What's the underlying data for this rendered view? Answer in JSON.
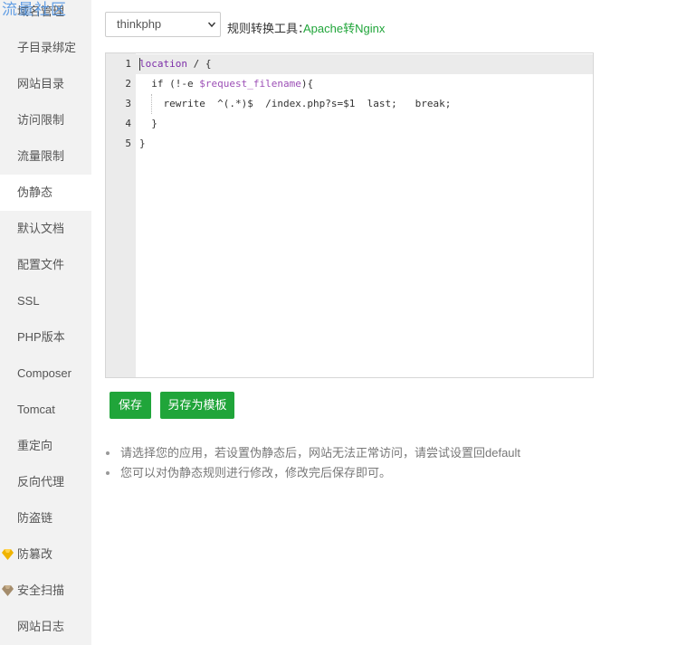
{
  "watermark": "流量社区",
  "sidebar": {
    "items": [
      {
        "label": "域名管理",
        "icon": ""
      },
      {
        "label": "子目录绑定",
        "icon": ""
      },
      {
        "label": "网站目录",
        "icon": ""
      },
      {
        "label": "访问限制",
        "icon": ""
      },
      {
        "label": "流量限制",
        "icon": ""
      },
      {
        "label": "伪静态",
        "icon": "",
        "active": true
      },
      {
        "label": "默认文档",
        "icon": ""
      },
      {
        "label": "配置文件",
        "icon": ""
      },
      {
        "label": "SSL",
        "icon": ""
      },
      {
        "label": "PHP版本",
        "icon": ""
      },
      {
        "label": "Composer",
        "icon": ""
      },
      {
        "label": "Tomcat",
        "icon": ""
      },
      {
        "label": "重定向",
        "icon": ""
      },
      {
        "label": "反向代理",
        "icon": ""
      },
      {
        "label": "防盗链",
        "icon": ""
      },
      {
        "label": "防篡改",
        "icon": "gold-gem-icon"
      },
      {
        "label": "安全扫描",
        "icon": "bronze-gem-icon"
      },
      {
        "label": "网站日志",
        "icon": ""
      }
    ]
  },
  "rule_select": {
    "value": "thinkphp"
  },
  "tool": {
    "label": "规则转换工具：",
    "link": "Apache转Nginx"
  },
  "editor": {
    "lines": [
      {
        "n": "1",
        "code": "location / {"
      },
      {
        "n": "2",
        "code": "  if (!-e $request_filename){"
      },
      {
        "n": "3",
        "code": "    rewrite  ^(.*)$  /index.php?s=$1  last;   break;"
      },
      {
        "n": "4",
        "code": "  }"
      },
      {
        "n": "5",
        "code": "}"
      }
    ]
  },
  "buttons": {
    "save": "保存",
    "save_template": "另存为模板"
  },
  "tips": [
    "请选择您的应用，若设置伪静态后，网站无法正常访问，请尝试设置回default",
    "您可以对伪静态规则进行修改，修改完后保存即可。"
  ],
  "colors": {
    "accent": "#20a53a",
    "sidebar_bg": "#f2f2f2",
    "gold": "#f0b400",
    "bronze": "#a48c6c"
  }
}
